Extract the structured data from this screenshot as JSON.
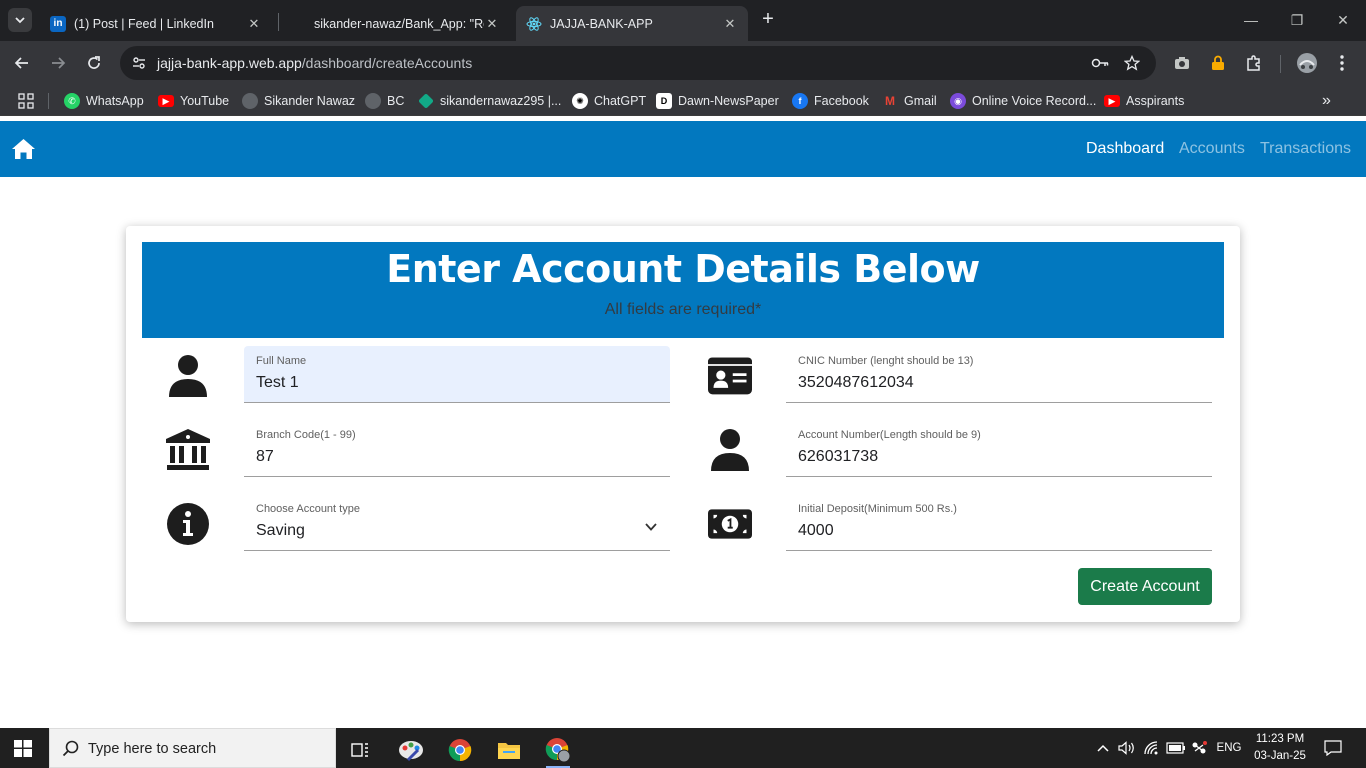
{
  "browser": {
    "tabs": [
      {
        "title": "(1) Post | Feed | LinkedIn",
        "icon": "linkedin-icon",
        "active": false
      },
      {
        "title": "sikander-nawaz/Bank_App: \"React",
        "icon": "github-icon",
        "active": false
      },
      {
        "title": "JAJJA-BANK-APP",
        "icon": "react-icon",
        "active": true
      }
    ],
    "url_host": "jajja-bank-app.web.app",
    "url_path": "/dashboard/createAccounts",
    "bookmarks": [
      {
        "label": "WhatsApp",
        "icon": "whatsapp-icon",
        "color": "#25d366"
      },
      {
        "label": "YouTube",
        "icon": "youtube-icon",
        "color": "#ff0000"
      },
      {
        "label": "Sikander Nawaz",
        "icon": "github-icon",
        "color": "#5f6368"
      },
      {
        "label": "BC",
        "icon": "github-icon",
        "color": "#5f6368"
      },
      {
        "label": "sikandernawaz295 |...",
        "icon": "diamond-icon",
        "color": "#12a987"
      },
      {
        "label": "ChatGPT",
        "icon": "chatgpt-icon",
        "color": "#ffffff"
      },
      {
        "label": "Dawn-NewsPaper",
        "icon": "dawn-icon",
        "color": "#ffffff"
      },
      {
        "label": "Facebook",
        "icon": "facebook-icon",
        "color": "#1877f2"
      },
      {
        "label": "Gmail",
        "icon": "gmail-icon",
        "color": "#ea4335"
      },
      {
        "label": "Online Voice Record...",
        "icon": "voice-recorder-icon",
        "color": "#7b4bdb"
      },
      {
        "label": "Asspirants",
        "icon": "youtube-icon",
        "color": "#ff0000"
      }
    ]
  },
  "app": {
    "nav": {
      "links": [
        "Dashboard",
        "Accounts",
        "Transactions"
      ],
      "active": "Dashboard"
    },
    "form": {
      "title": "Enter Account Details Below",
      "subtitle": "All fields are required*",
      "full_name": {
        "label": "Full Name",
        "value": "Test 1"
      },
      "cnic": {
        "label": "CNIC Number (lenght should be 13)",
        "value": "3520487612034"
      },
      "branch_code": {
        "label": "Branch Code(1 - 99)",
        "value": "87"
      },
      "account_number": {
        "label": "Account Number(Length should be 9)",
        "value": "626031738"
      },
      "account_type": {
        "label": "Choose Account type",
        "value": "Saving"
      },
      "initial_deposit": {
        "label": "Initial Deposit(Minimum 500 Rs.)",
        "value": "4000"
      },
      "submit_label": "Create Account"
    },
    "colors": {
      "primary": "#0278bf",
      "success": "#1b7b4a",
      "filled_field": "#e8f0fe"
    }
  },
  "taskbar": {
    "search_placeholder": "Type here to search",
    "language": "ENG",
    "time": "11:23 PM",
    "date": "03-Jan-25"
  }
}
